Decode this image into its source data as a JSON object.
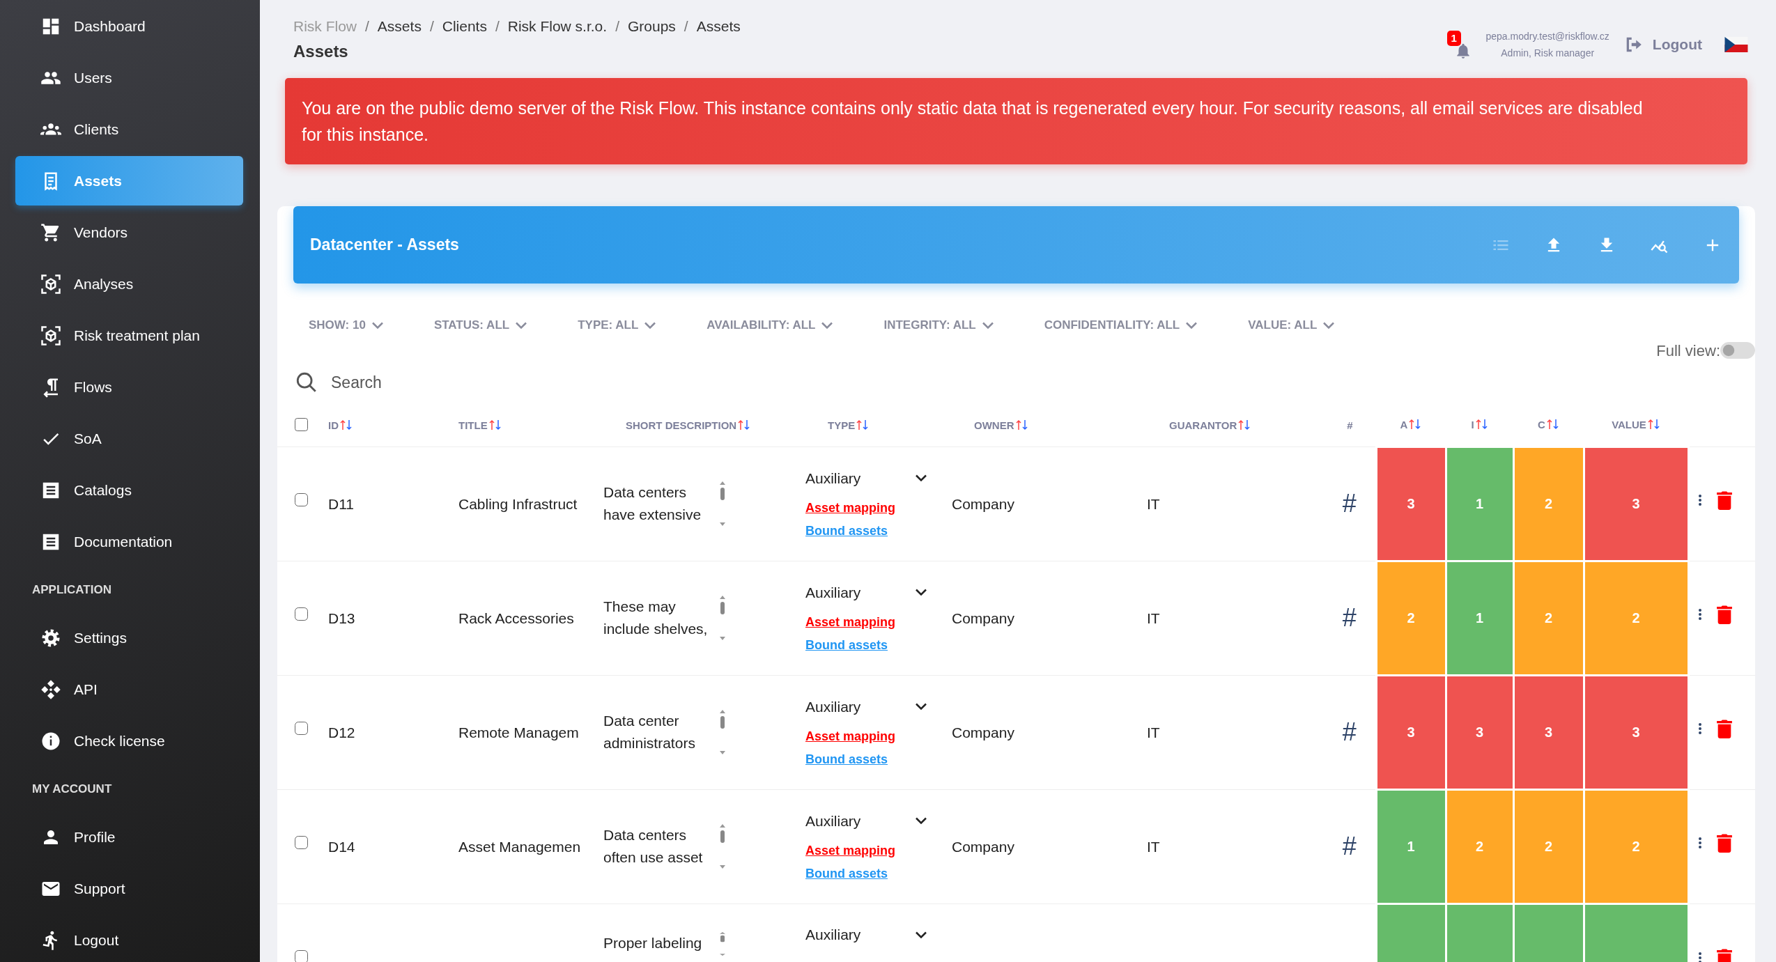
{
  "sidebar": {
    "groups": [
      {
        "items": [
          {
            "label": "Dashboard",
            "selected": false
          },
          {
            "label": "Users",
            "selected": false
          },
          {
            "label": "Clients",
            "selected": false
          },
          {
            "label": "Assets",
            "selected": true
          },
          {
            "label": "Vendors",
            "selected": false
          },
          {
            "label": "Analyses",
            "selected": false
          },
          {
            "label": "Risk treatment plan",
            "selected": false
          },
          {
            "label": "Flows",
            "selected": false
          },
          {
            "label": "SoA",
            "selected": false
          },
          {
            "label": "Catalogs",
            "selected": false
          },
          {
            "label": "Documentation",
            "selected": false
          }
        ]
      },
      {
        "heading": "APPLICATION",
        "items": [
          {
            "label": "Settings",
            "selected": false
          },
          {
            "label": "API",
            "selected": false
          },
          {
            "label": "Check license",
            "selected": false
          }
        ]
      },
      {
        "heading": "MY ACCOUNT",
        "items": [
          {
            "label": "Profile",
            "selected": false
          },
          {
            "label": "Support",
            "selected": false
          },
          {
            "label": "Logout",
            "selected": false
          }
        ]
      }
    ]
  },
  "breadcrumb": [
    {
      "label": "Risk Flow",
      "muted": true
    },
    {
      "separator": "/",
      "label": "Assets",
      "muted": false
    },
    {
      "separator": "/",
      "label": "Clients",
      "muted": false
    },
    {
      "separator": "/",
      "label": "Risk Flow s.r.o.",
      "muted": false
    },
    {
      "separator": "/",
      "label": "Groups",
      "muted": false
    },
    {
      "separator": "/",
      "label": "Assets",
      "muted": false
    }
  ],
  "page_title": "Assets",
  "user": {
    "notifications": "1",
    "email": "pepa.modry.test@riskflow.cz",
    "roles": "Admin, Risk manager",
    "logout": "Logout"
  },
  "alert": "You are on the public demo server of the Risk Flow. This instance contains only static data that is regenerated every hour. For security reasons, all email services are disabled for this instance.",
  "card": {
    "title": "Datacenter - Assets",
    "header_actions": [
      {
        "disabled": true
      },
      {
        "disabled": false
      },
      {
        "disabled": false
      },
      {
        "disabled": false
      },
      {
        "disabled": false
      }
    ],
    "filters": [
      "SHOW: 10",
      "STATUS: ALL",
      "TYPE: ALL",
      "AVAILABILITY: ALL",
      "INTEGRITY: ALL",
      "CONFIDENTIALITY: ALL",
      "VALUE: ALL"
    ],
    "full_view": {
      "label": "Full view:",
      "on": false
    },
    "search": {
      "placeholder": "Search"
    },
    "table": {
      "all_checked": false,
      "columns": [
        {
          "label": "ID",
          "sortable": true
        },
        {
          "label": "TITLE",
          "sortable": true
        },
        {
          "label": "SHORT DESCRIPTION",
          "sortable": true
        },
        {
          "label": "TYPE",
          "sortable": true
        },
        {
          "label": "OWNER",
          "sortable": true
        },
        {
          "label": "GUARANTOR",
          "sortable": true
        },
        {
          "label": "#",
          "sortable": false
        },
        {
          "label": "A",
          "sortable": true
        },
        {
          "label": "I",
          "sortable": true
        },
        {
          "label": "C",
          "sortable": true
        },
        {
          "label": "VALUE",
          "sortable": true
        }
      ],
      "rows": [
        {
          "checked": false,
          "id": "D11",
          "title": "Cabling Infrastruct",
          "description": "Data centers have extensive",
          "type": "Auxiliary",
          "mapping_link": "Asset mapping",
          "bound_link": "Bound assets",
          "owner": "Company",
          "guarantor": "IT",
          "tag": "#",
          "scores": [
            {
              "value": "3",
              "color": "#ef5350"
            },
            {
              "value": "1",
              "color": "#66bb6a"
            },
            {
              "value": "2",
              "color": "#ffa726"
            },
            {
              "value": "3",
              "color": "#ef5350"
            }
          ]
        },
        {
          "checked": false,
          "id": "D13",
          "title": "Rack Accessories",
          "description": "These may include shelves,",
          "type": "Auxiliary",
          "mapping_link": "Asset mapping",
          "bound_link": "Bound assets",
          "owner": "Company",
          "guarantor": "IT",
          "tag": "#",
          "scores": [
            {
              "value": "2",
              "color": "#ffa726"
            },
            {
              "value": "1",
              "color": "#66bb6a"
            },
            {
              "value": "2",
              "color": "#ffa726"
            },
            {
              "value": "2",
              "color": "#ffa726"
            }
          ]
        },
        {
          "checked": false,
          "id": "D12",
          "title": "Remote Managem",
          "description": "Data center administrators",
          "type": "Auxiliary",
          "mapping_link": "Asset mapping",
          "bound_link": "Bound assets",
          "owner": "Company",
          "guarantor": "IT",
          "tag": "#",
          "scores": [
            {
              "value": "3",
              "color": "#ef5350"
            },
            {
              "value": "3",
              "color": "#ef5350"
            },
            {
              "value": "3",
              "color": "#ef5350"
            },
            {
              "value": "3",
              "color": "#ef5350"
            }
          ]
        },
        {
          "checked": false,
          "id": "D14",
          "title": "Asset Managemen",
          "description": "Data centers often use asset",
          "type": "Auxiliary",
          "mapping_link": "Asset mapping",
          "bound_link": "Bound assets",
          "owner": "Company",
          "guarantor": "IT",
          "tag": "#",
          "scores": [
            {
              "value": "1",
              "color": "#66bb6a"
            },
            {
              "value": "2",
              "color": "#ffa726"
            },
            {
              "value": "2",
              "color": "#ffa726"
            },
            {
              "value": "2",
              "color": "#ffa726"
            }
          ]
        },
        {
          "checked": false,
          "description": "Proper labeling",
          "type": "Auxiliary",
          "scores": [
            {
              "color": "#66bb6a"
            },
            {
              "color": "#66bb6a"
            },
            {
              "color": "#66bb6a"
            },
            {
              "color": "#66bb6a"
            }
          ]
        }
      ]
    }
  }
}
